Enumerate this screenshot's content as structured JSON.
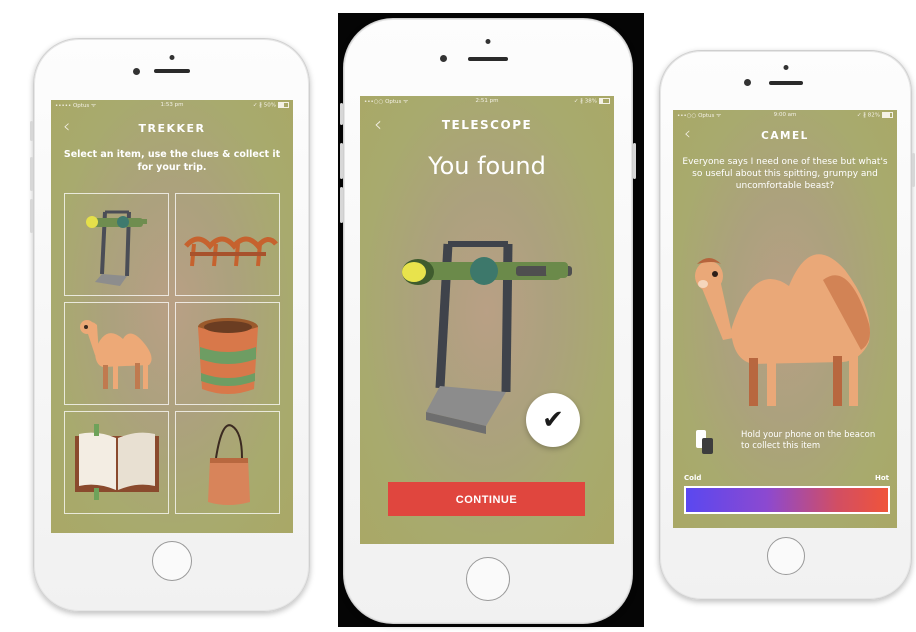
{
  "screen1": {
    "status": {
      "carrier": "••••• Optus ᯤ",
      "time": "1:53 pm",
      "right": "✓ ∦ 50%"
    },
    "title": "TREKKER",
    "instruction": "Select an item, use the clues & collect it for your trip.",
    "items": [
      {
        "name": "Telescope",
        "icon": "telescope-icon"
      },
      {
        "name": "Camel saddle",
        "icon": "saddle-icon"
      },
      {
        "name": "Camel",
        "icon": "camel-icon"
      },
      {
        "name": "Basket",
        "icon": "basket-icon"
      },
      {
        "name": "Book",
        "icon": "book-icon"
      },
      {
        "name": "Bag",
        "icon": "bag-icon"
      }
    ]
  },
  "screen2": {
    "status": {
      "carrier": "•••○○ Optus ᯤ",
      "time": "2:51 pm",
      "right": "✓ ∦ 38%"
    },
    "title": "TELESCOPE",
    "heading": "You found",
    "continue_label": "CONTINUE"
  },
  "screen3": {
    "status": {
      "carrier": "•••○○ Optus ᯤ",
      "time": "9:00 am",
      "right": "✓ ∦ 82%"
    },
    "title": "CAMEL",
    "clue": "Everyone says I need one of these but what's so useful about this spitting, grumpy and uncomfortable beast?",
    "hint": "Hold your phone on the beacon to collect this item",
    "cold_label": "Cold",
    "hot_label": "Hot"
  },
  "colors": {
    "accent": "#e0463e",
    "background": "#a9a866",
    "heat_cold": "#5a48f0",
    "heat_hot": "#f0543a"
  }
}
